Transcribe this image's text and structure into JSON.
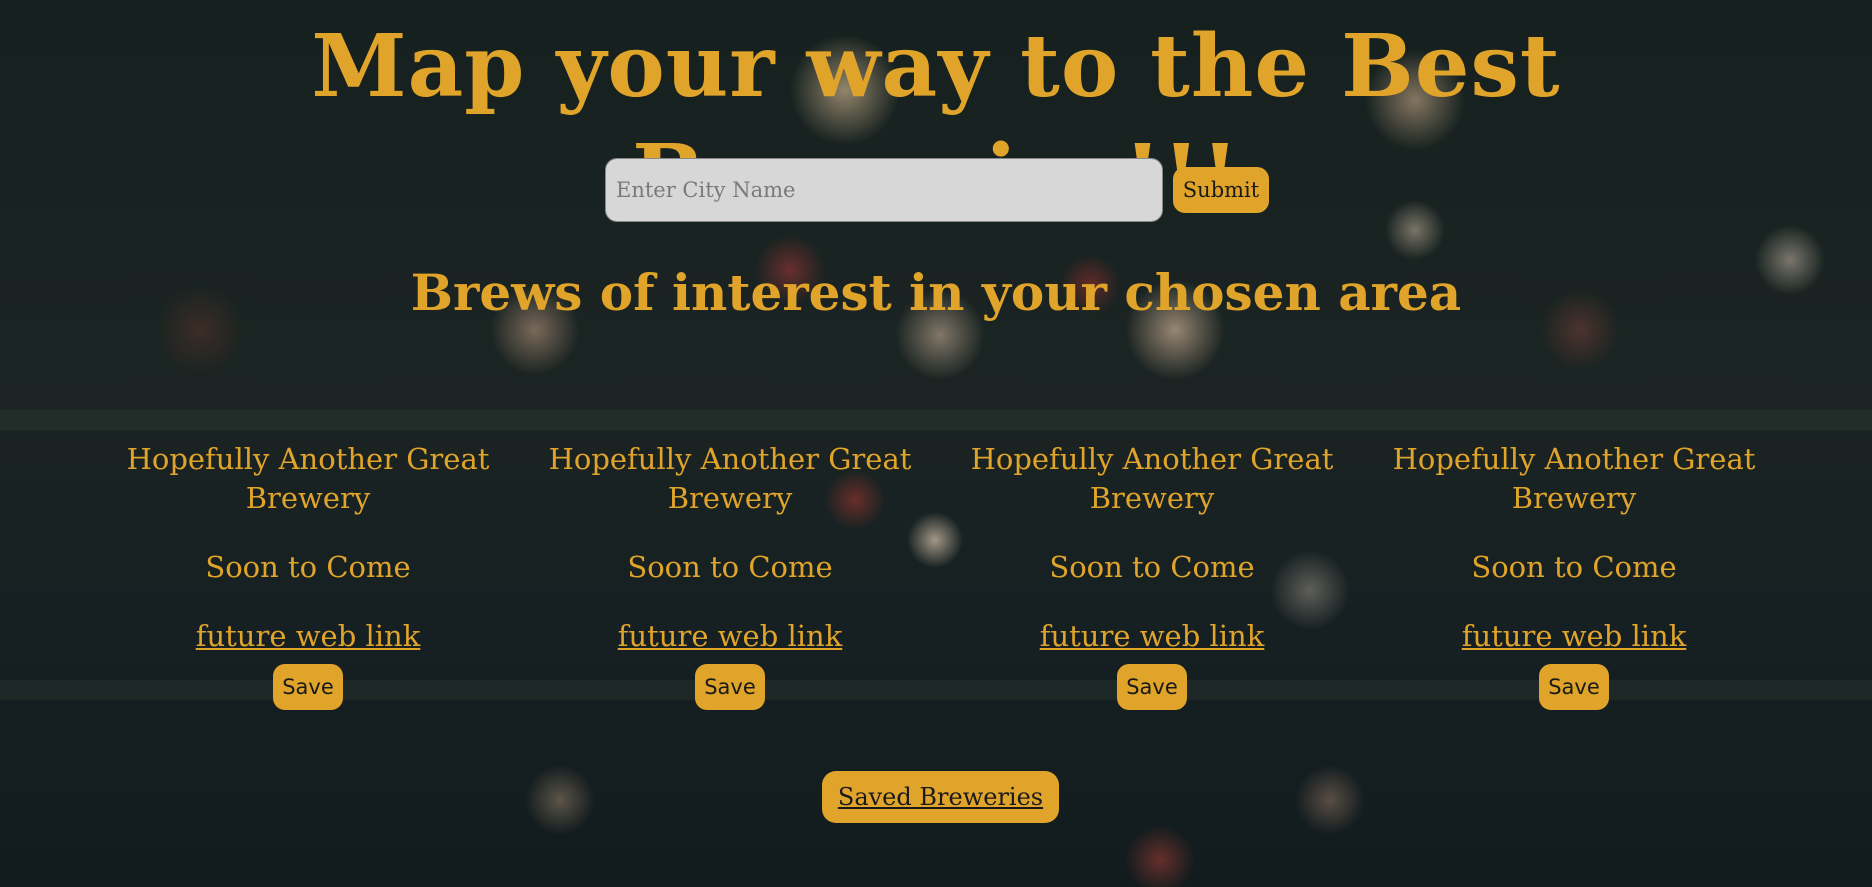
{
  "header": {
    "title": "Map your way to the Best Breweries!!!"
  },
  "search": {
    "placeholder": "Enter City Name",
    "value": "",
    "submit_label": "Submit"
  },
  "results": {
    "heading": "Brews of interest in your chosen area",
    "cards": [
      {
        "name": "Hopefully Another Great Brewery",
        "status": "Soon to Come",
        "link": "future web link",
        "save_label": "Save"
      },
      {
        "name": "Hopefully Another Great Brewery",
        "status": "Soon to Come",
        "link": "future web link",
        "save_label": "Save"
      },
      {
        "name": "Hopefully Another Great Brewery",
        "status": "Soon to Come",
        "link": "future web link",
        "save_label": "Save"
      },
      {
        "name": "Hopefully Another Great Brewery",
        "status": "Soon to Come",
        "link": "future web link",
        "save_label": "Save"
      }
    ]
  },
  "footer": {
    "saved_label": "Saved Breweries"
  },
  "colors": {
    "accent": "#e0a42a",
    "input_bg": "#d7d7d7",
    "button_text": "#1a1a1a"
  }
}
